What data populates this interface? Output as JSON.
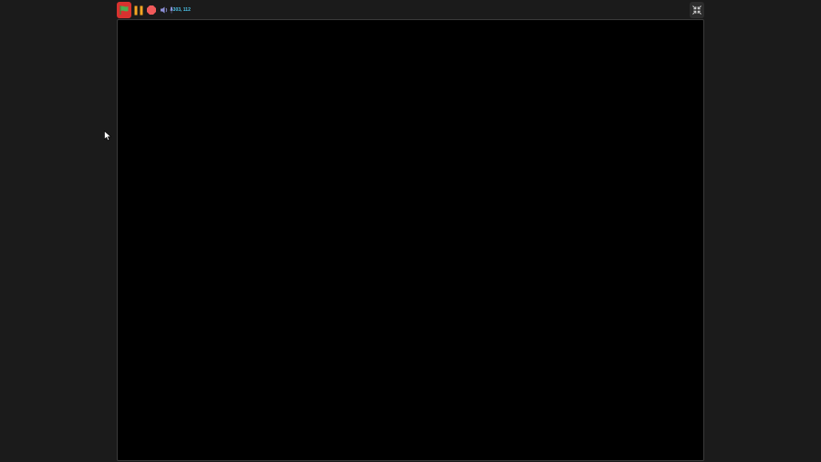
{
  "toolbar": {
    "coordinates": "-303, 112",
    "colors": {
      "flag_background": "#d8322f",
      "flag_icon": "#4caf50",
      "pause_icon": "#f5a623",
      "stop_icon": "#f05a5a",
      "speaker_icon": "#8c8fd6",
      "coordinates_text": "#4cc3ea"
    },
    "icons": {
      "green_flag": "green-flag-icon",
      "pause": "pause-icon",
      "stop": "stop-icon",
      "mute": "speaker-icon",
      "mic": "microphone-icon",
      "fullscreen": "exit-fullscreen-icon"
    }
  },
  "stage": {
    "background": "#000000"
  },
  "page": {
    "background": "#1b1b1b"
  }
}
